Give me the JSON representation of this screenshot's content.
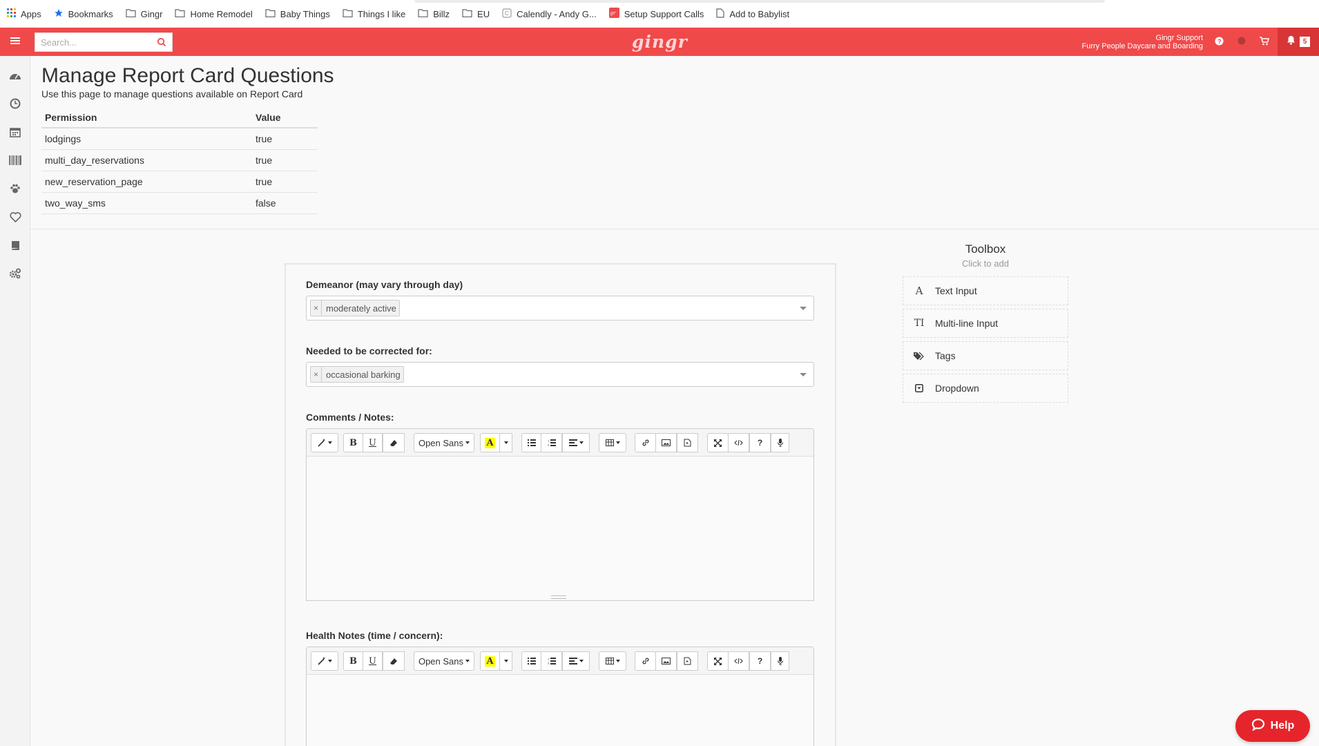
{
  "bookmarks": [
    {
      "label": "Apps",
      "icon": "apps-grid-icon"
    },
    {
      "label": "Bookmarks",
      "icon": "star-icon"
    },
    {
      "label": "Gingr",
      "icon": "folder-icon"
    },
    {
      "label": "Home Remodel",
      "icon": "folder-icon"
    },
    {
      "label": "Baby Things",
      "icon": "folder-icon"
    },
    {
      "label": "Things I like",
      "icon": "folder-icon"
    },
    {
      "label": "Billz",
      "icon": "folder-icon"
    },
    {
      "label": "EU",
      "icon": "folder-icon"
    },
    {
      "label": "Calendly - Andy G...",
      "icon": "calendly-icon"
    },
    {
      "label": "Setup Support Calls",
      "icon": "gingr-favicon-icon"
    },
    {
      "label": "Add to Babylist",
      "icon": "page-icon"
    }
  ],
  "header": {
    "search_placeholder": "Search...",
    "logo_text": "gingr",
    "account_name": "Gingr Support",
    "account_business": "Furry People Daycare and Boarding",
    "notification_count": "5",
    "accent_color": "#f0494a"
  },
  "sidebar_icons": [
    "dashboard-icon",
    "clock-icon",
    "calendar-icon",
    "barcode-icon",
    "paw-icon",
    "heart-icon",
    "book-icon",
    "settings-icon"
  ],
  "page": {
    "title": "Manage Report Card Questions",
    "subtitle": "Use this page to manage questions available on Report Card"
  },
  "permissions": {
    "headers": [
      "Permission",
      "Value"
    ],
    "rows": [
      [
        "lodgings",
        "true"
      ],
      [
        "multi_day_reservations",
        "true"
      ],
      [
        "new_reservation_page",
        "true"
      ],
      [
        "two_way_sms",
        "false"
      ]
    ]
  },
  "form": {
    "demeanor": {
      "label": "Demeanor (may vary through day)",
      "tag": "moderately active"
    },
    "corrected": {
      "label": "Needed to be corrected for:",
      "tag": "occasional barking"
    },
    "comments": {
      "label": "Comments / Notes:"
    },
    "health": {
      "label": "Health Notes (time / concern):"
    },
    "editor_font": "Open Sans"
  },
  "toolbox": {
    "title": "Toolbox",
    "subtitle": "Click to add",
    "items": [
      {
        "label": "Text Input",
        "icon": "A"
      },
      {
        "label": "Multi-line Input",
        "icon": "TI"
      },
      {
        "label": "Tags",
        "icon": "tags-icon"
      },
      {
        "label": "Dropdown",
        "icon": "dropdown-icon"
      }
    ]
  },
  "help_label": "Help"
}
